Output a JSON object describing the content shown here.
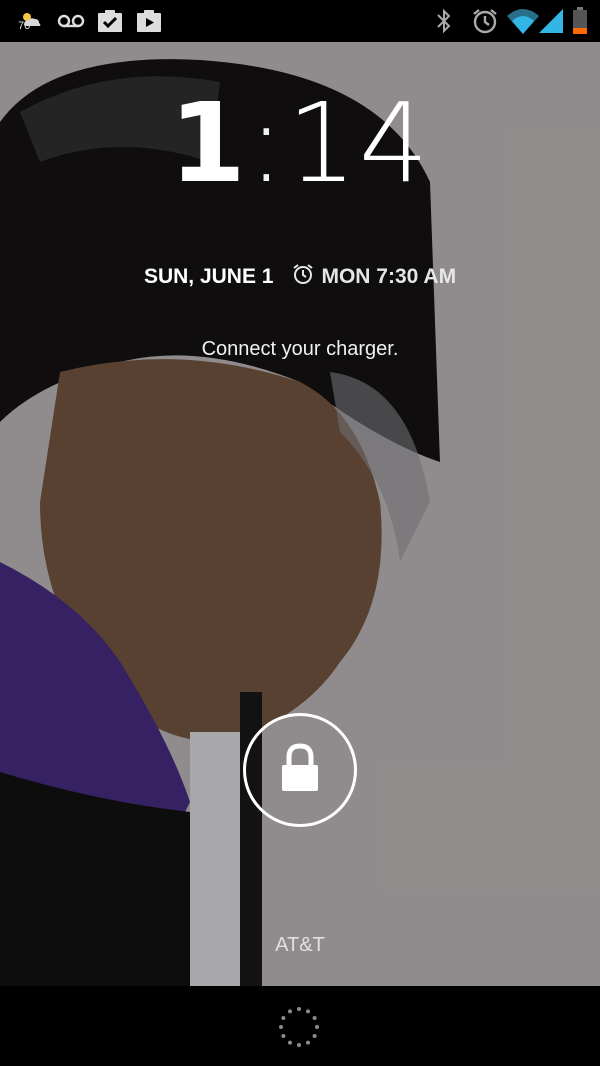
{
  "status_bar": {
    "weather_temp": "76°",
    "left_icons": [
      "weather-icon",
      "voicemail-icon",
      "task-check-icon",
      "play-store-icon"
    ],
    "right_icons": [
      "bluetooth-icon",
      "alarm-icon",
      "wifi-icon",
      "signal-icon",
      "battery-icon"
    ]
  },
  "lockscreen": {
    "clock_hour": "1",
    "clock_colon": ":",
    "clock_minutes": "14",
    "date": "SUN, JUNE 1",
    "alarm": "MON 7:30 AM",
    "charger_message": "Connect your charger.",
    "carrier": "AT&T",
    "lock_icon": "padlock-icon"
  },
  "colors": {
    "background": "#000000",
    "text": "#ffffff",
    "wifi_signal": "#33b5e5",
    "battery_low": "#ff6a00"
  }
}
